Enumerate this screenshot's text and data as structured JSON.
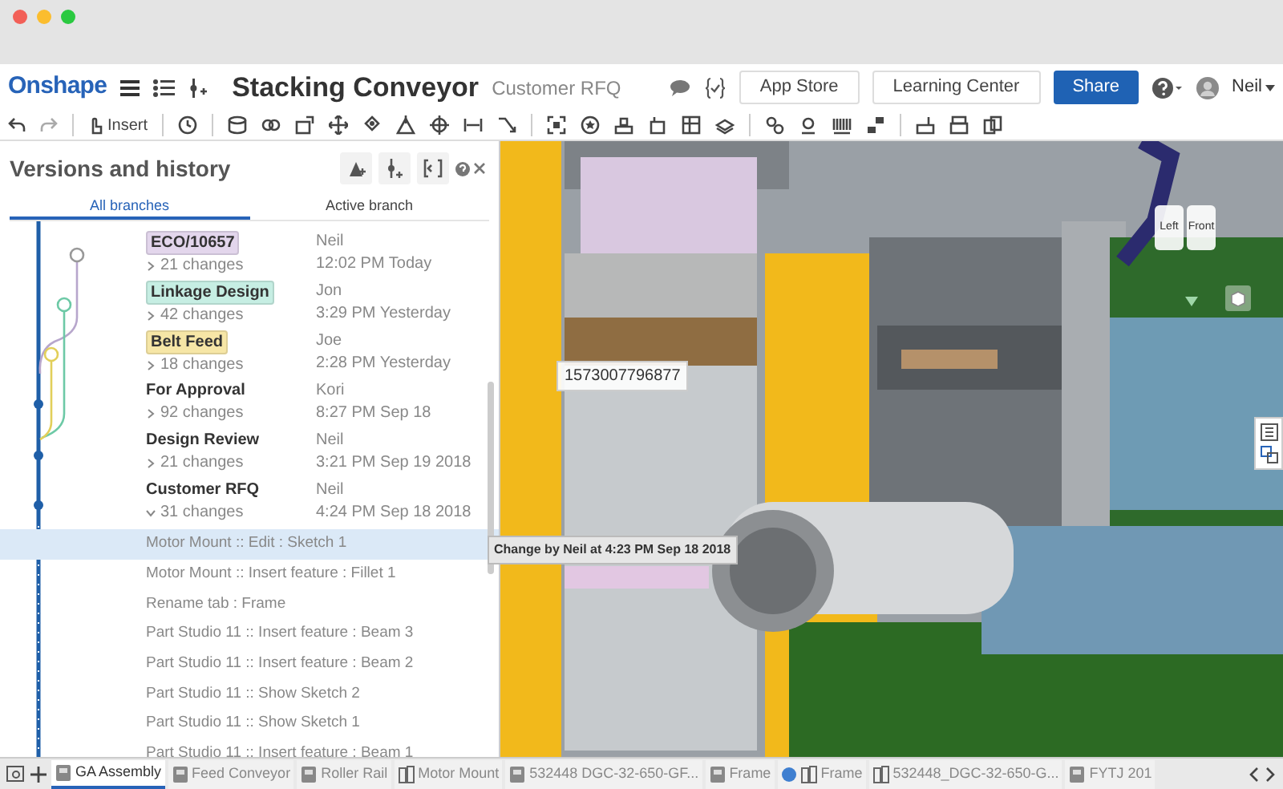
{
  "app": {
    "logo": "Onshape",
    "title": "Stacking Conveyor",
    "subtitle": "Customer RFQ"
  },
  "header_buttons": [
    {
      "label": "App Store",
      "kind": "plain"
    },
    {
      "label": "Learning Center",
      "kind": "plain"
    },
    {
      "label": "Share",
      "kind": "primary"
    }
  ],
  "user": {
    "name": "Neil"
  },
  "toolbar": {
    "insert_label": "Insert"
  },
  "panel": {
    "title": "Versions and history",
    "tabs": [
      {
        "label": "All branches",
        "selected": true
      },
      {
        "label": "Active branch",
        "selected": false
      }
    ],
    "versions": [
      {
        "name": "ECO/10657",
        "color": "#e3d6ec",
        "author": "Neil",
        "changes": "21 changes",
        "time": "12:02 PM Today",
        "expanded": false
      },
      {
        "name": "Linkage Design",
        "color": "#c6eee3",
        "author": "Jon",
        "changes": "42 changes",
        "time": "3:29 PM Yesterday",
        "expanded": false
      },
      {
        "name": "Belt Feed",
        "color": "#f6e6a6",
        "author": "Joe",
        "changes": "18 changes",
        "time": "2:28 PM Yesterday",
        "expanded": false
      },
      {
        "name": "For Approval",
        "author": "Kori",
        "changes": "92 changes",
        "time": "8:27 PM Sep 18",
        "expanded": false
      },
      {
        "name": "Design Review",
        "author": "Neil",
        "changes": "21 changes",
        "time": "3:21 PM Sep 19 2018",
        "expanded": false
      },
      {
        "name": "Customer RFQ",
        "author": "Neil",
        "changes": "31 changes",
        "time": "4:24 PM Sep 18 2018",
        "expanded": true
      }
    ],
    "history": [
      {
        "label": "Motor Mount :: Edit : Sketch 1",
        "selected": true
      },
      {
        "label": "Motor Mount :: Insert feature : Fillet 1",
        "selected": false
      },
      {
        "label": "Rename tab : Frame",
        "selected": false
      },
      {
        "label": "Part Studio 11 :: Insert feature : Beam 3",
        "selected": false
      },
      {
        "label": "Part Studio 11 :: Insert feature : Beam 2",
        "selected": false
      },
      {
        "label": "Part Studio 11 :: Show Sketch 2",
        "selected": false
      },
      {
        "label": "Part Studio 11 :: Show Sketch 1",
        "selected": false
      },
      {
        "label": "Part Studio 11 :: Insert feature : Beam 1",
        "selected": false
      }
    ]
  },
  "viewport": {
    "measure_label": "1573007796877",
    "tooltip": "Change by Neil at 4:23 PM Sep 18 2018",
    "view_cube": [
      "Left",
      "Front"
    ]
  },
  "doc_tabs": [
    {
      "label": "GA Assembly",
      "kind": "studio",
      "selected": true
    },
    {
      "label": "Feed Conveyor",
      "kind": "studio",
      "selected": false
    },
    {
      "label": "Roller Rail",
      "kind": "studio",
      "selected": false
    },
    {
      "label": "Motor Mount",
      "kind": "assembly",
      "selected": false
    },
    {
      "label": "532448 DGC-32-650-GF...",
      "kind": "studio",
      "selected": false
    },
    {
      "label": "Frame",
      "kind": "studio",
      "selected": false
    },
    {
      "label": "Frame",
      "kind": "linked",
      "selected": false
    },
    {
      "label": "532448_DGC-32-650-G...",
      "kind": "assembly",
      "selected": false
    },
    {
      "label": "FYTJ 201",
      "kind": "studio",
      "selected": false
    }
  ]
}
